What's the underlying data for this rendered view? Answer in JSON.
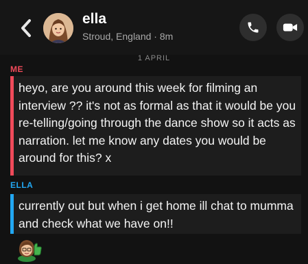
{
  "header": {
    "contact_name": "ella",
    "subtitle": "Stroud, England · 8m",
    "icons": {
      "back": "chevron-left-icon",
      "call": "phone-icon",
      "video": "video-camera-icon"
    }
  },
  "date_divider": "1 APRIL",
  "messages": [
    {
      "sender": "ME",
      "text": "heyo, are you around this week for filming an interview ?? it's not as formal as that it would be you re-telling/going through the dance show so it acts as narration. let me know any dates you would be around for this? x"
    },
    {
      "sender": "ELLA",
      "text": "currently out but when i get home ill chat to mumma and check what we have on!!"
    }
  ],
  "colors": {
    "me": "#ef4a5a",
    "ella": "#22a7f2",
    "background": "#121212"
  }
}
